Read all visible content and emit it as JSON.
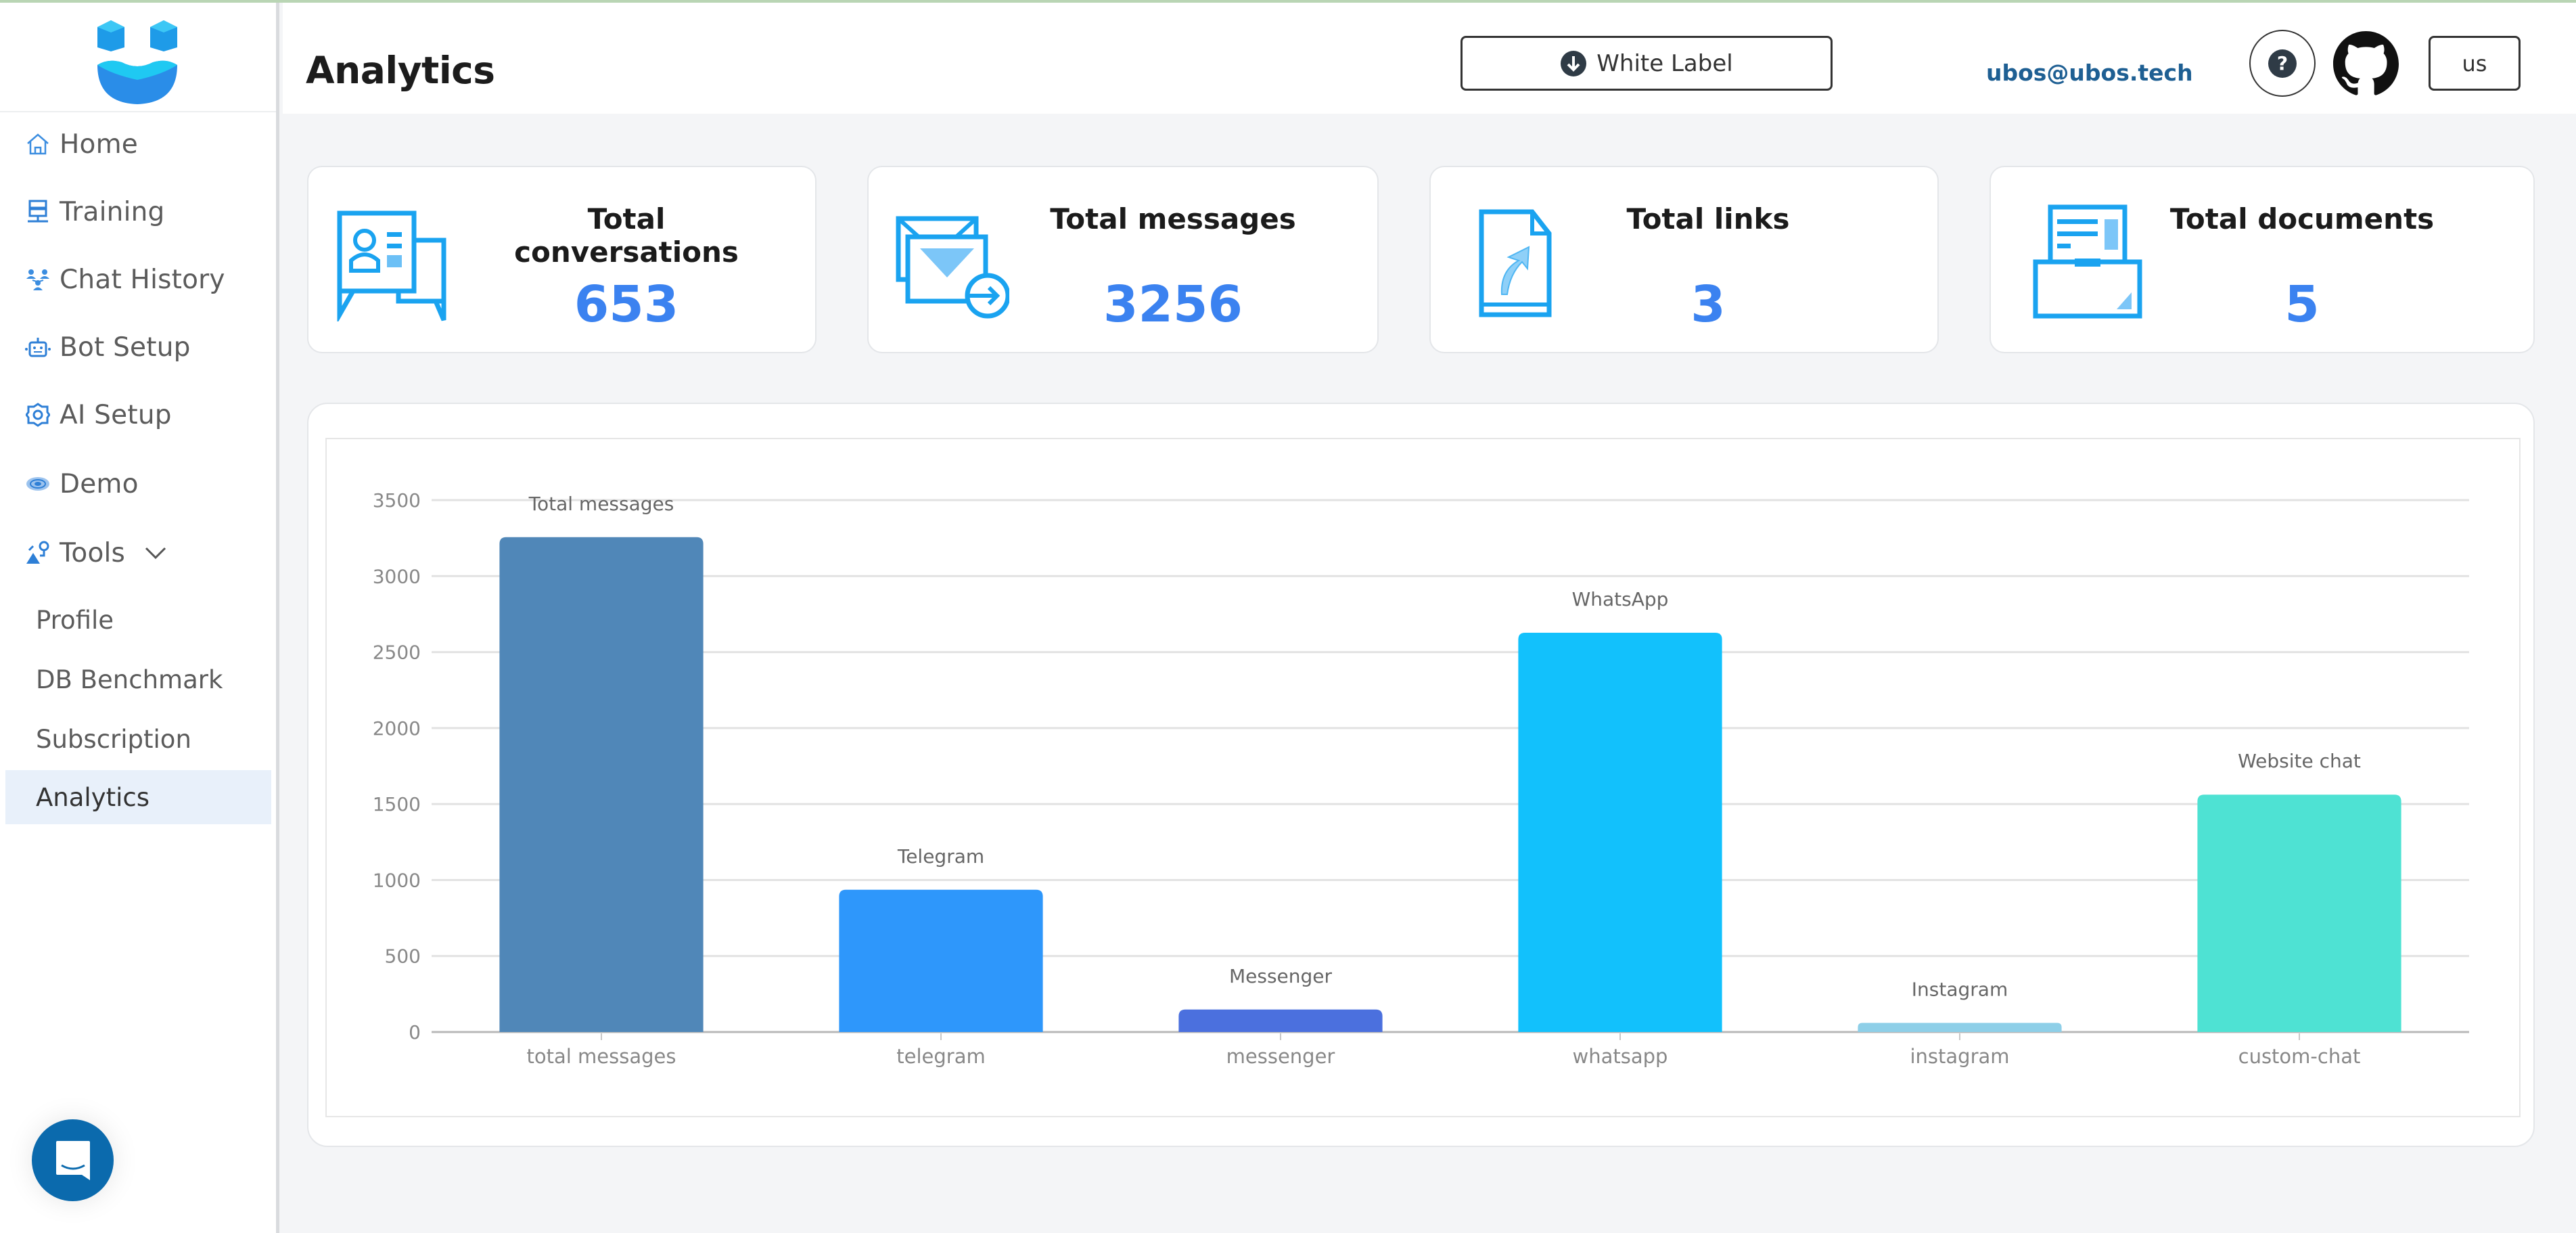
{
  "sidebar": {
    "logo": "ubos-logo",
    "items": [
      {
        "label": "Home",
        "icon": "home-icon"
      },
      {
        "label": "Training",
        "icon": "server-icon"
      },
      {
        "label": "Chat History",
        "icon": "users-network-icon"
      },
      {
        "label": "Bot Setup",
        "icon": "robot-icon"
      },
      {
        "label": "AI Setup",
        "icon": "gear-icon"
      },
      {
        "label": "Demo",
        "icon": "eye-icon"
      },
      {
        "label": "Tools",
        "icon": "tools-icon",
        "expanded": true
      }
    ],
    "sub_items": [
      {
        "label": "Profile",
        "active": false
      },
      {
        "label": "DB Benchmark",
        "active": false
      },
      {
        "label": "Subscription",
        "active": false
      },
      {
        "label": "Analytics",
        "active": true
      }
    ],
    "chat_widget": "chat-bubble-icon"
  },
  "header": {
    "title": "Analytics",
    "white_label_button": "White Label",
    "email": "ubos@ubos.tech",
    "help_icon": "question-icon",
    "github_icon": "github-icon",
    "language_button": "us"
  },
  "cards": [
    {
      "title": "Total conversations",
      "value": "653",
      "icon": "conversation-icon"
    },
    {
      "title": "Total messages",
      "value": "3256",
      "icon": "envelope-send-icon"
    },
    {
      "title": "Total links",
      "value": "3",
      "icon": "link-document-icon"
    },
    {
      "title": "Total documents",
      "value": "5",
      "icon": "document-tray-icon"
    }
  ],
  "colors": {
    "accent": "#3b82f0",
    "email": "#1e5f93",
    "active_nav_bg": "#e8f0fa",
    "chat_widget": "#0b6aad"
  },
  "chart_data": {
    "type": "bar",
    "title": "",
    "xlabel": "",
    "ylabel": "",
    "categories": [
      "total messages",
      "telegram",
      "messenger",
      "whatsapp",
      "instagram",
      "custom-chat"
    ],
    "bar_labels": [
      "Total messages",
      "Telegram",
      "Messenger",
      "WhatsApp",
      "Instagram",
      "Website chat"
    ],
    "values": [
      3256,
      936,
      148,
      2627,
      60,
      1562
    ],
    "colors": [
      "#5087b8",
      "#2e97fb",
      "#4b70de",
      "#12c1fc",
      "#8ecfe8",
      "#4ee2d3"
    ],
    "ylim": [
      0,
      3500
    ],
    "yticks": [
      0,
      500,
      1000,
      1500,
      2000,
      2500,
      3000,
      3500
    ],
    "grid": true,
    "legend": "none"
  }
}
